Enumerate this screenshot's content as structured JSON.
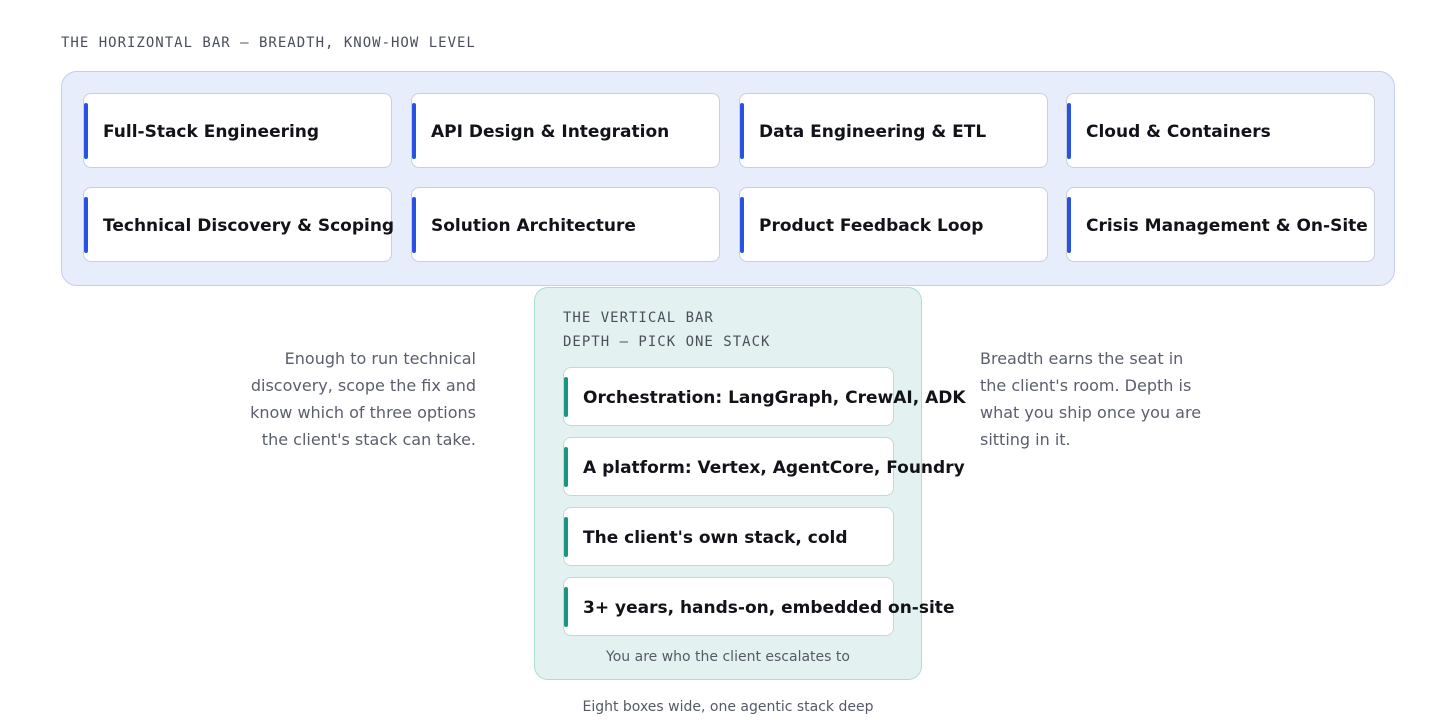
{
  "horizontal_bar": {
    "title": "THE HORIZONTAL BAR — BREADTH, KNOW-HOW LEVEL",
    "accent_color": "#2952e3",
    "background_color": "#e8edfc",
    "items": [
      "Full-Stack Engineering",
      "API Design & Integration",
      "Data Engineering & ETL",
      "Cloud & Containers",
      "Technical Discovery & Scoping",
      "Solution Architecture",
      "Product Feedback Loop",
      "Crisis Management & On-Site"
    ]
  },
  "vertical_bar": {
    "title_line1": "THE VERTICAL BAR",
    "title_line2": "DEPTH — PICK ONE STACK",
    "accent_color": "#1c9484",
    "background_color": "#e3f2f0",
    "items": [
      "Orchestration: LangGraph, CrewAI, ADK",
      "A platform: Vertex, AgentCore, Foundry",
      "The client's own stack, cold",
      "3+ years, hands-on, embedded on-site"
    ],
    "footer": "You are who the client escalates to"
  },
  "left_note": "Enough to run technical\ndiscovery, scope the fix and\nknow which of three options\nthe client's stack can take.",
  "right_note": "Breadth earns the seat in\nthe client's room. Depth is\nwhat you ship once you are\nsitting in it.",
  "caption": "Eight boxes wide, one agentic stack deep"
}
